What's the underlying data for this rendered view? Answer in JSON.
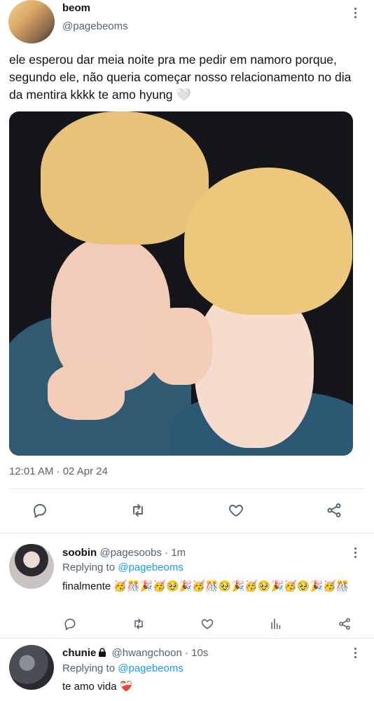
{
  "tweet": {
    "author_name": "beom",
    "author_handle": "@pagebeoms",
    "text": "ele esperou dar meia noite pra me pedir em namoro porque, segundo ele, não queria começar nosso relacionamento no dia da mentira kkkk te amo hyung 🤍",
    "timestamp": "12:01 AM · 02 Apr 24",
    "actions": [
      "reply-icon",
      "retweet-icon",
      "like-icon",
      "share-icon"
    ]
  },
  "replies": [
    {
      "name": "soobin",
      "handle": "@pagesoobs",
      "separator": "·",
      "time": "1m",
      "replying_prefix": "Replying to ",
      "replying_to": "@pagebeoms",
      "text": "finalmente 🥳🎊🎉🥳🥹🎉🥳🎊🥹🎉🥳🥹🎉🥳🥹🎉🥳🎊",
      "actions": [
        "reply-icon",
        "retweet-icon",
        "like-icon",
        "views-icon",
        "share-icon"
      ]
    },
    {
      "name": "chunie",
      "locked": true,
      "handle": "@hwangchoon",
      "separator": "·",
      "time": "10s",
      "replying_prefix": "Replying to ",
      "replying_to": "@pagebeoms",
      "text": "te amo vida ❤️‍🩹"
    }
  ],
  "colors": {
    "text": "#0f1419",
    "secondary": "#536471",
    "accent": "#1d9bf0",
    "divider": "#e4e8eb"
  }
}
